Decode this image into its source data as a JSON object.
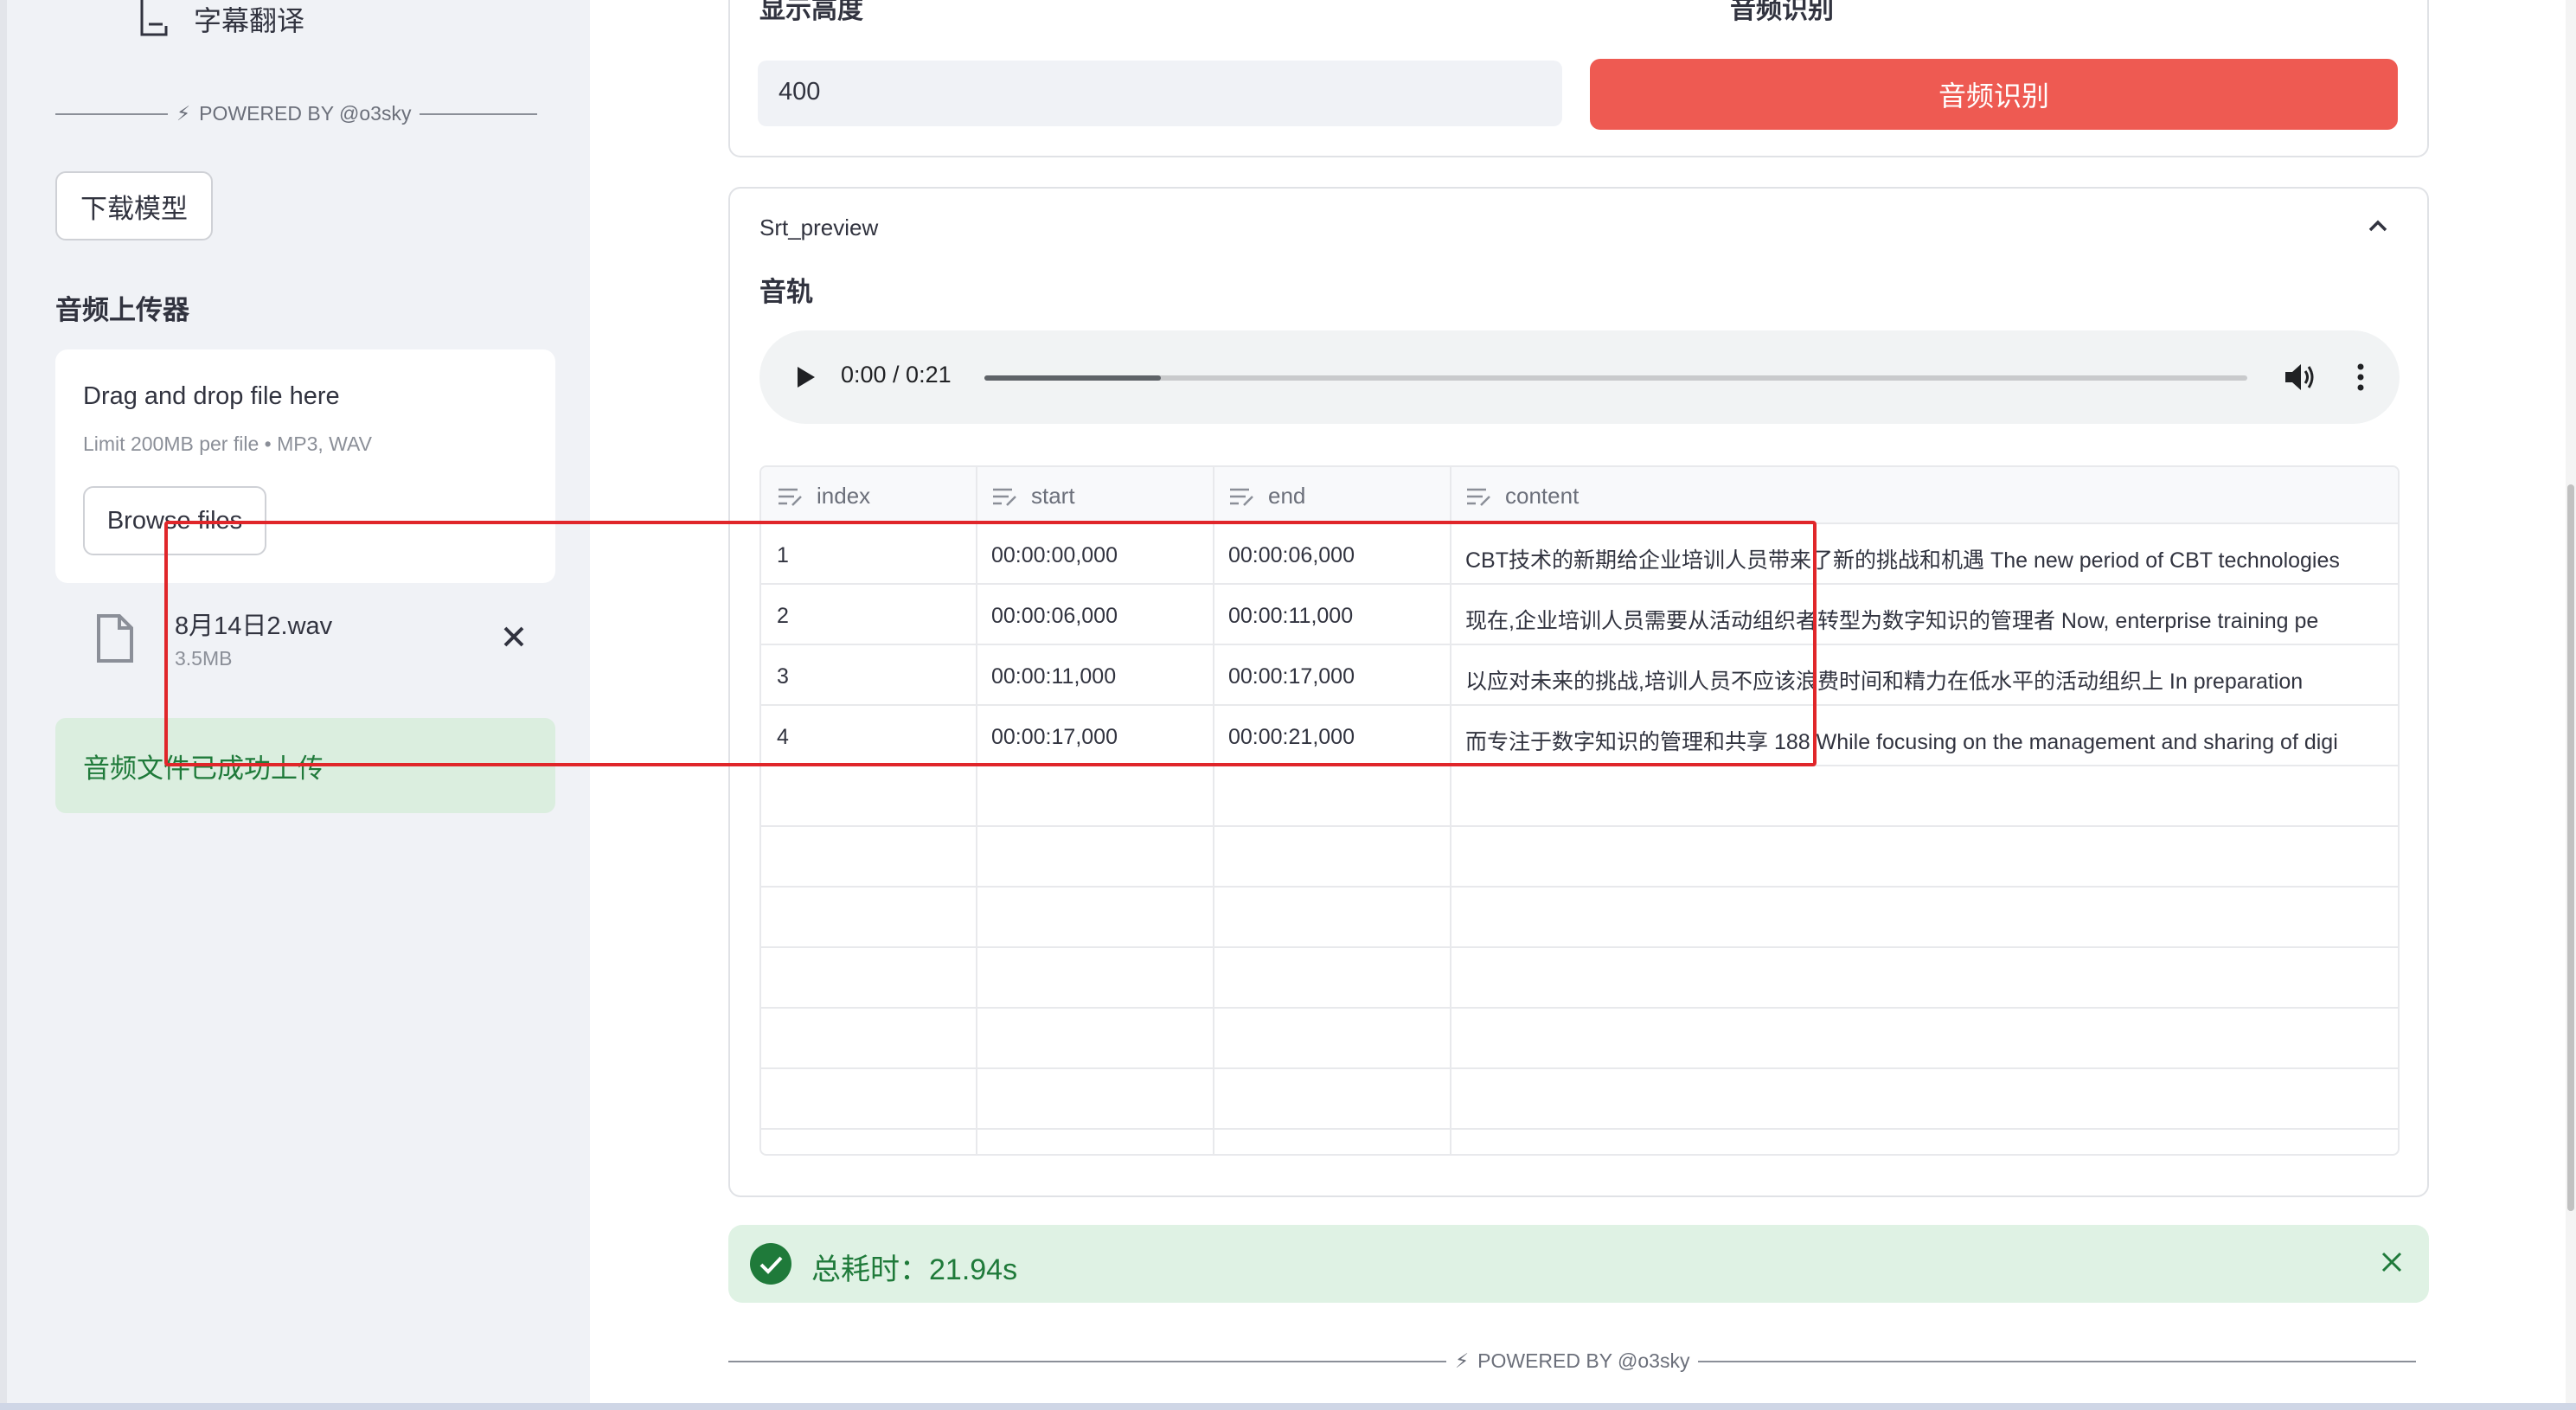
{
  "sidebar": {
    "nav_item_label": "字幕翻译",
    "powered_by": "POWERED BY @o3sky",
    "download_model_button": "下载模型",
    "uploader_title": "音频上传器",
    "dropzone": {
      "title": "Drag and drop file here",
      "subtitle": "Limit 200MB per file • MP3, WAV",
      "browse_button": "Browse files"
    },
    "uploaded_file": {
      "name": "8月14日2.wav",
      "size": "3.5MB"
    },
    "success_message": "音频文件已成功上传"
  },
  "main": {
    "height_label": "显示高度",
    "recognize_label": "音频识别",
    "height_value": "400",
    "minus": "−",
    "plus": "+",
    "recognize_button": "音频识别",
    "expander_title": "Srt_preview",
    "track_title": "音轨",
    "audio": {
      "time": "0:00 / 0:21",
      "progress": 0.14
    },
    "table": {
      "columns": [
        "index",
        "start",
        "end",
        "content"
      ],
      "rows": [
        [
          "1",
          "00:00:00,000",
          "00:00:06,000",
          "CBT技术的新期给企业培训人员带来了新的挑战和机遇 The new period of CBT technologies"
        ],
        [
          "2",
          "00:00:06,000",
          "00:00:11,000",
          "现在,企业培训人员需要从活动组织者转型为数字知识的管理者 Now, enterprise training pe"
        ],
        [
          "3",
          "00:00:11,000",
          "00:00:17,000",
          "以应对未来的挑战,培训人员不应该浪费时间和精力在低水平的活动组织上 In preparation"
        ],
        [
          "4",
          "00:00:17,000",
          "00:00:21,000",
          "而专注于数字知识的管理和共享 188 While focusing on the management and sharing of digi"
        ]
      ]
    },
    "alert_text": "总耗时：21.94s",
    "powered_by": "POWERED BY @o3sky"
  },
  "colors": {
    "primary_red": "#ee5a52",
    "success_green": "#1f7a3a",
    "highlight_red": "#e0262a"
  }
}
